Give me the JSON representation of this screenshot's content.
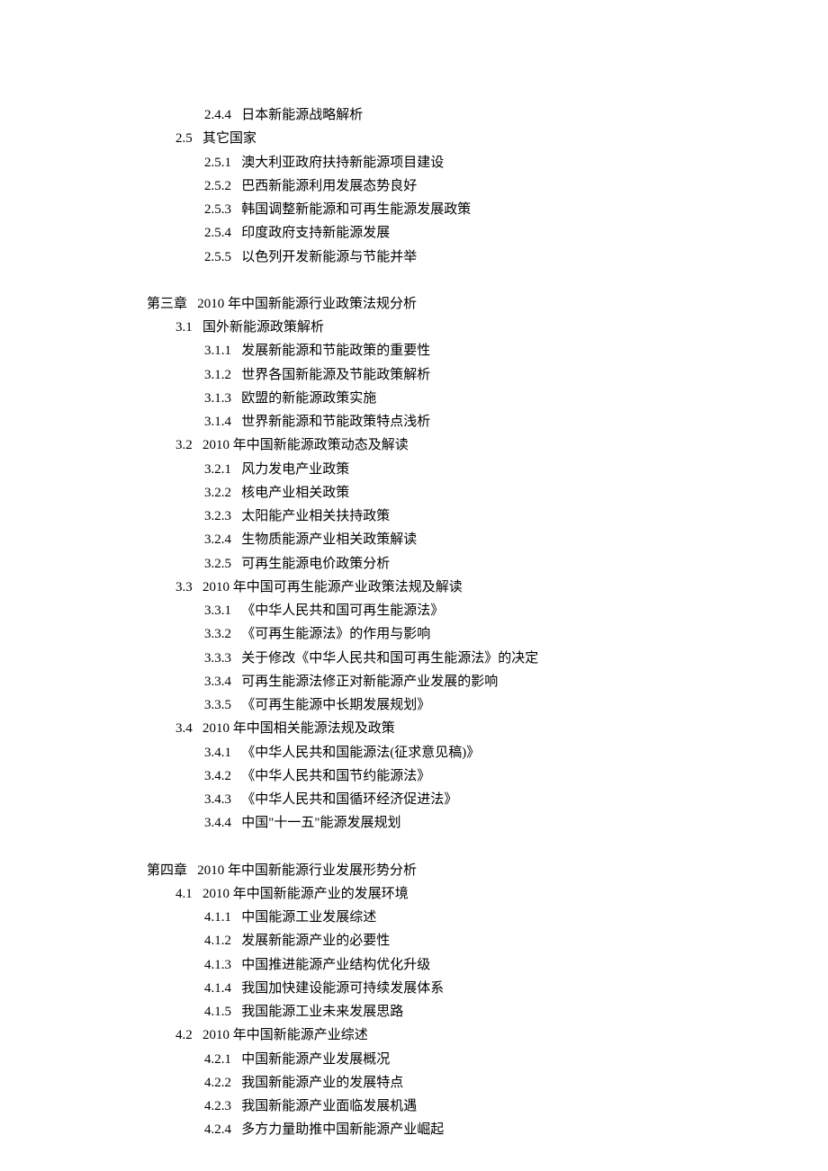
{
  "lines": [
    {
      "level": 2,
      "num": "2.4.4",
      "text": "日本新能源战略解析"
    },
    {
      "level": 1,
      "num": "2.5",
      "text": "其它国家"
    },
    {
      "level": 2,
      "num": "2.5.1",
      "text": "澳大利亚政府扶持新能源项目建设"
    },
    {
      "level": 2,
      "num": "2.5.2",
      "text": "巴西新能源利用发展态势良好"
    },
    {
      "level": 2,
      "num": "2.5.3",
      "text": "韩国调整新能源和可再生能源发展政策"
    },
    {
      "level": 2,
      "num": "2.5.4",
      "text": "印度政府支持新能源发展"
    },
    {
      "level": 2,
      "num": "2.5.5",
      "text": "以色列开发新能源与节能并举"
    },
    {
      "level": -1
    },
    {
      "level": 0,
      "num": "第三章",
      "text": "2010 年中国新能源行业政策法规分析"
    },
    {
      "level": 1,
      "num": "3.1",
      "text": "国外新能源政策解析"
    },
    {
      "level": 2,
      "num": "3.1.1",
      "text": "发展新能源和节能政策的重要性"
    },
    {
      "level": 2,
      "num": "3.1.2",
      "text": "世界各国新能源及节能政策解析"
    },
    {
      "level": 2,
      "num": "3.1.3",
      "text": "欧盟的新能源政策实施"
    },
    {
      "level": 2,
      "num": "3.1.4",
      "text": "世界新能源和节能政策特点浅析"
    },
    {
      "level": 1,
      "num": "3.2",
      "text": "2010 年中国新能源政策动态及解读"
    },
    {
      "level": 2,
      "num": "3.2.1",
      "text": "风力发电产业政策"
    },
    {
      "level": 2,
      "num": "3.2.2",
      "text": "核电产业相关政策"
    },
    {
      "level": 2,
      "num": "3.2.3",
      "text": "太阳能产业相关扶持政策"
    },
    {
      "level": 2,
      "num": "3.2.4",
      "text": "生物质能源产业相关政策解读"
    },
    {
      "level": 2,
      "num": "3.2.5",
      "text": "可再生能源电价政策分析"
    },
    {
      "level": 1,
      "num": "3.3",
      "text": "2010 年中国可再生能源产业政策法规及解读"
    },
    {
      "level": 2,
      "num": "3.3.1",
      "text": "《中华人民共和国可再生能源法》"
    },
    {
      "level": 2,
      "num": "3.3.2",
      "text": "《可再生能源法》的作用与影响"
    },
    {
      "level": 2,
      "num": "3.3.3",
      "text": "关于修改《中华人民共和国可再生能源法》的决定"
    },
    {
      "level": 2,
      "num": "3.3.4",
      "text": "可再生能源法修正对新能源产业发展的影响"
    },
    {
      "level": 2,
      "num": "3.3.5",
      "text": "《可再生能源中长期发展规划》"
    },
    {
      "level": 1,
      "num": "3.4",
      "text": "2010 年中国相关能源法规及政策"
    },
    {
      "level": 2,
      "num": "3.4.1",
      "text": "《中华人民共和国能源法(征求意见稿)》"
    },
    {
      "level": 2,
      "num": "3.4.2",
      "text": "《中华人民共和国节约能源法》"
    },
    {
      "level": 2,
      "num": "3.4.3",
      "text": "《中华人民共和国循环经济促进法》"
    },
    {
      "level": 2,
      "num": "3.4.4",
      "text": "中国\"十一五\"能源发展规划"
    },
    {
      "level": -1
    },
    {
      "level": 0,
      "num": "第四章",
      "text": "2010 年中国新能源行业发展形势分析"
    },
    {
      "level": 1,
      "num": "4.1",
      "text": "2010 年中国新能源产业的发展环境"
    },
    {
      "level": 2,
      "num": "4.1.1",
      "text": "中国能源工业发展综述"
    },
    {
      "level": 2,
      "num": "4.1.2",
      "text": "发展新能源产业的必要性"
    },
    {
      "level": 2,
      "num": "4.1.3",
      "text": "中国推进能源产业结构优化升级"
    },
    {
      "level": 2,
      "num": "4.1.4",
      "text": "我国加快建设能源可持续发展体系"
    },
    {
      "level": 2,
      "num": "4.1.5",
      "text": "我国能源工业未来发展思路"
    },
    {
      "level": 1,
      "num": "4.2",
      "text": "2010 年中国新能源产业综述"
    },
    {
      "level": 2,
      "num": "4.2.1",
      "text": "中国新能源产业发展概况"
    },
    {
      "level": 2,
      "num": "4.2.2",
      "text": "我国新能源产业的发展特点"
    },
    {
      "level": 2,
      "num": "4.2.3",
      "text": "我国新能源产业面临发展机遇"
    },
    {
      "level": 2,
      "num": "4.2.4",
      "text": "多方力量助推中国新能源产业崛起"
    }
  ]
}
